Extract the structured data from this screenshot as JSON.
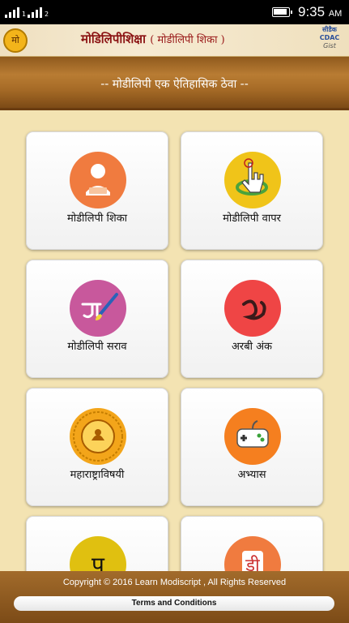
{
  "status_bar": {
    "sim1_label": "1",
    "sim2_label": "2",
    "time": "9:35",
    "time_suffix": "AM"
  },
  "header": {
    "app_title": "मोडिलिपीशिक्षा",
    "app_subtitle": "( मोडीलिपी शिका )",
    "logo_left_text": "मो",
    "logo_right_line1": "सीडैक",
    "logo_right_line2": "CDAC",
    "logo_right_line3": "Gist"
  },
  "banner": {
    "text": "-- मोडीलिपी एक ऐतिहासिक ठेवा --"
  },
  "menu": {
    "tiles": [
      {
        "label": "मोडीलिपी शिका",
        "icon": "learn-person-icon",
        "color": "#f07b3f"
      },
      {
        "label": "मोडीलिपी वापर",
        "icon": "touch-hand-icon",
        "color": "#f0c419"
      },
      {
        "label": "मोडीलिपी सराव",
        "icon": "brush-practice-icon",
        "color": "#c8589c"
      },
      {
        "label": "अरबी अंक",
        "icon": "arabic-numeral-icon",
        "color": "#ef4545"
      },
      {
        "label": "महाराष्ट्राविषयी",
        "icon": "maharashtra-seal-icon",
        "color": "#f3a51a"
      },
      {
        "label": "अभ्यास",
        "icon": "game-controller-icon",
        "color": "#f57f1f"
      },
      {
        "label": "",
        "icon": "modi-glyph-icon",
        "color": "#e0c010"
      },
      {
        "label": "",
        "icon": "dictionary-icon",
        "color": "#f07b3f"
      }
    ],
    "tile7_glyph": "प",
    "tile8_glyph": "डी"
  },
  "footer": {
    "copyright": "Copyright © 2016 Learn Modiscript , All Rights Reserved",
    "terms_label": "Terms and Conditions"
  }
}
